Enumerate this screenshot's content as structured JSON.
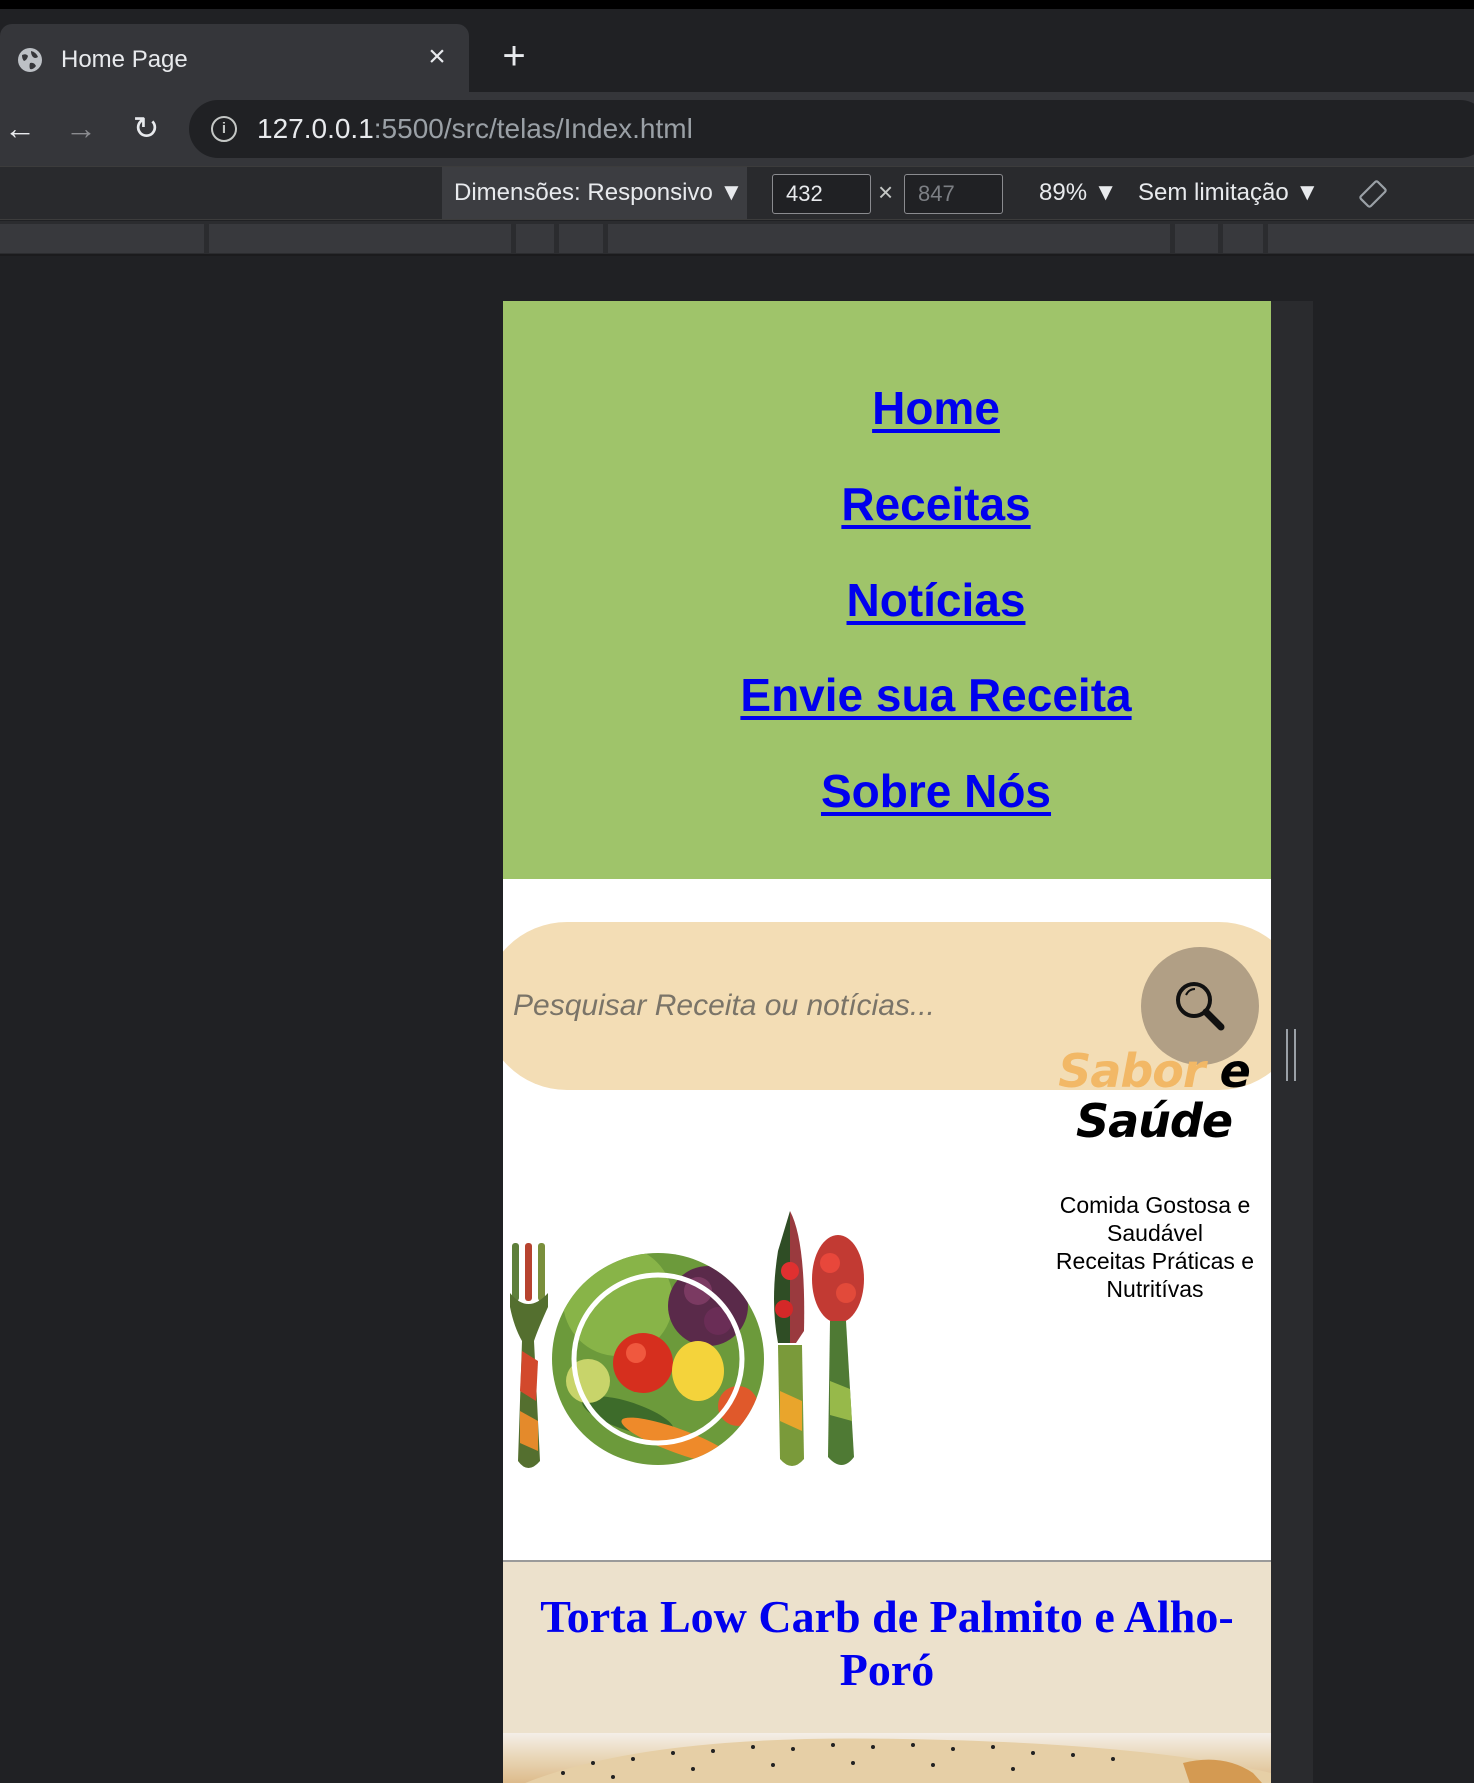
{
  "browser": {
    "tab": {
      "title": "Home Page",
      "close_glyph": "×",
      "favicon": "globe-icon"
    },
    "new_tab_glyph": "+",
    "nav": {
      "back": "←",
      "forward": "→",
      "reload": "↻"
    },
    "address": {
      "host": "127.0.0.1",
      "rest": ":5500/src/telas/Index.html",
      "info_glyph": "i"
    }
  },
  "devtools": {
    "dimensions_label": "Dimensões: Responsivo ▼",
    "width": "432",
    "height": "847",
    "times": "×",
    "zoom": "89% ▼",
    "throttle": "Sem limitação ▼",
    "rotate_icon": "rotate-icon"
  },
  "page": {
    "nav": {
      "items": [
        "Home",
        "Receitas",
        "Notícias",
        "Envie sua Receita",
        "Sobre Nós"
      ]
    },
    "search": {
      "placeholder": "Pesquisar Receita ou notícias...",
      "button_icon": "search-icon"
    },
    "brand": {
      "sabor": "Sabor",
      "e": "e",
      "saude": "Saúde"
    },
    "tagline": {
      "line1": "Comida Gostosa e",
      "line2": "Saudável",
      "line3": "Receitas Práticas e",
      "line4": "Nutritívas"
    },
    "recipe": {
      "title": "Torta Low Carb de Palmito e Alho-Poró"
    },
    "colors": {
      "nav_bg": "#9fc46a",
      "link": "#0000ee",
      "search_bg": "#f3ddb5",
      "search_btn": "#b19f85",
      "brand_accent": "#f2b866",
      "recipe_bg": "#ece1cc"
    }
  }
}
